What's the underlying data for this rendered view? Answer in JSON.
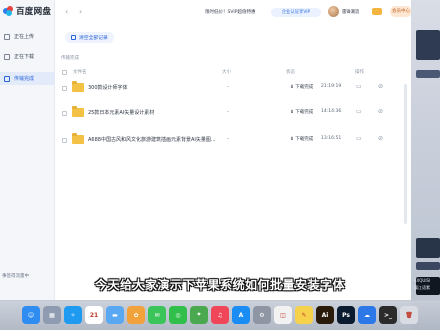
{
  "sidebar": {
    "logo_text": "百度网盘",
    "items": [
      {
        "label": "正在上传"
      },
      {
        "label": "正在下载"
      },
      {
        "label": "传输完成"
      }
    ],
    "footer": "事签得流量中"
  },
  "titlebar": {
    "promo": "限时低价！SVIP超值特惠",
    "vip_badge": "企业认证享VIP",
    "username": "雷锋潮流",
    "renew_label": "会员中心"
  },
  "main": {
    "clear_button": "清空全部记录",
    "section_label": "传输完成",
    "columns": {
      "name": "文件名",
      "size": "大小",
      "status": "状态",
      "ops": "操作"
    },
    "rows": [
      {
        "name": "300款设计师字体",
        "size": "-",
        "status": "下载完成",
        "time": "21:19:19"
      },
      {
        "name": "25款日本元素AI矢量设计素材",
        "size": "-",
        "status": "下载完成",
        "time": "14:14:36"
      },
      {
        "name": "A688中国古风和风文化旅游建筑插画元素背景AI矢量图...",
        "size": "-",
        "status": "下载完成",
        "time": "13:16:51"
      }
    ]
  },
  "subtitle": "今天给大家演示下苹果系统如何批量安装字体",
  "desktop": {
    "thumb_text_1": "EXQUISI",
    "thumb_text_2": "蒲江语素"
  },
  "dock": [
    {
      "name": "finder",
      "color": "#2f8cf0",
      "glyph": "☺"
    },
    {
      "name": "launchpad",
      "color": "#8e9bb0",
      "glyph": "▦"
    },
    {
      "name": "safari",
      "color": "#1e9bf0",
      "glyph": "✧"
    },
    {
      "name": "calendar",
      "color": "#ffffff",
      "glyph": "21"
    },
    {
      "name": "folder",
      "color": "#5aa8f2",
      "glyph": "▬"
    },
    {
      "name": "photos",
      "color": "#f2a23a",
      "glyph": "✿"
    },
    {
      "name": "messages",
      "color": "#3bc45a",
      "glyph": "✉"
    },
    {
      "name": "wechat",
      "color": "#2fbf4a",
      "glyph": "◎"
    },
    {
      "name": "maps",
      "color": "#4aa84f",
      "glyph": "⌖"
    },
    {
      "name": "music",
      "color": "#f0465a",
      "glyph": "♫"
    },
    {
      "name": "appstore",
      "color": "#1a8df5",
      "glyph": "A"
    },
    {
      "name": "settings",
      "color": "#8e96a3",
      "glyph": "⚙"
    },
    {
      "name": "preview",
      "color": "#f2f2f2",
      "glyph": "◫"
    },
    {
      "name": "notes",
      "color": "#f6d24c",
      "glyph": "✎"
    },
    {
      "name": "illustrator",
      "color": "#2a1a0a",
      "glyph": "Ai"
    },
    {
      "name": "photoshop",
      "color": "#0a1a2f",
      "glyph": "Ps"
    },
    {
      "name": "netdisk",
      "color": "#2c78e8",
      "glyph": "☁"
    },
    {
      "name": "terminal",
      "color": "#2b2b2b",
      "glyph": ">_"
    },
    {
      "name": "trash",
      "color": "#d9dde3",
      "glyph": "🗑"
    }
  ]
}
